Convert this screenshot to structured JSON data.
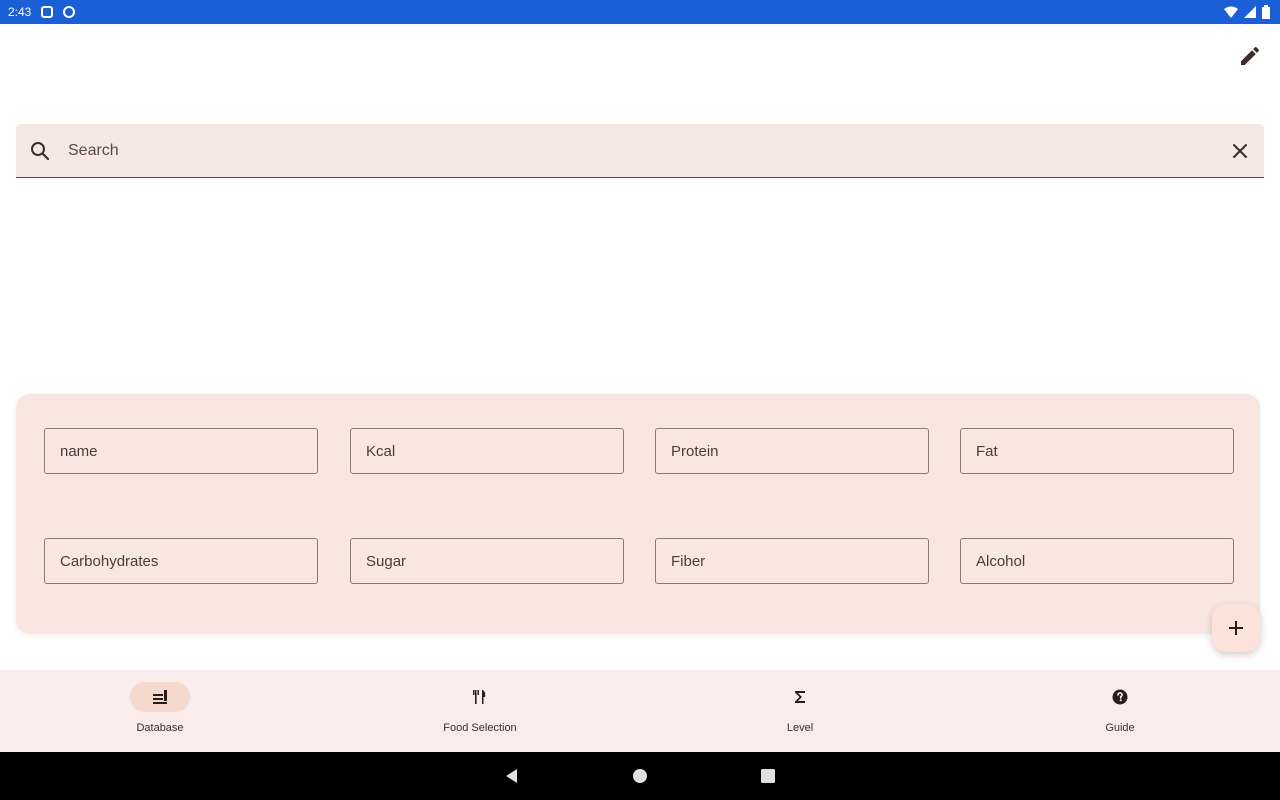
{
  "status_bar": {
    "time": "2:43"
  },
  "search": {
    "placeholder": "Search",
    "value": ""
  },
  "form": {
    "fields": [
      {
        "placeholder": "name"
      },
      {
        "placeholder": "Kcal"
      },
      {
        "placeholder": "Protein"
      },
      {
        "placeholder": "Fat"
      },
      {
        "placeholder": "Carbohydrates"
      },
      {
        "placeholder": "Sugar"
      },
      {
        "placeholder": "Fiber"
      },
      {
        "placeholder": "Alcohol"
      }
    ]
  },
  "fab": {
    "icon": "add-icon"
  },
  "bottom_nav": {
    "items": [
      {
        "label": "Database",
        "icon": "database-icon",
        "active": true
      },
      {
        "label": "Food Selection",
        "icon": "restaurant-icon",
        "active": false
      },
      {
        "label": "Level",
        "icon": "sigma-icon",
        "active": false
      },
      {
        "label": "Guide",
        "icon": "help-icon",
        "active": false
      }
    ]
  },
  "colors": {
    "status_bar": "#1a5fd6",
    "surface_tint": "#f8e6e0",
    "search_bg": "#f6e8e3",
    "nav_bg": "#f9ecea",
    "active_pill": "#f5d9cf"
  }
}
